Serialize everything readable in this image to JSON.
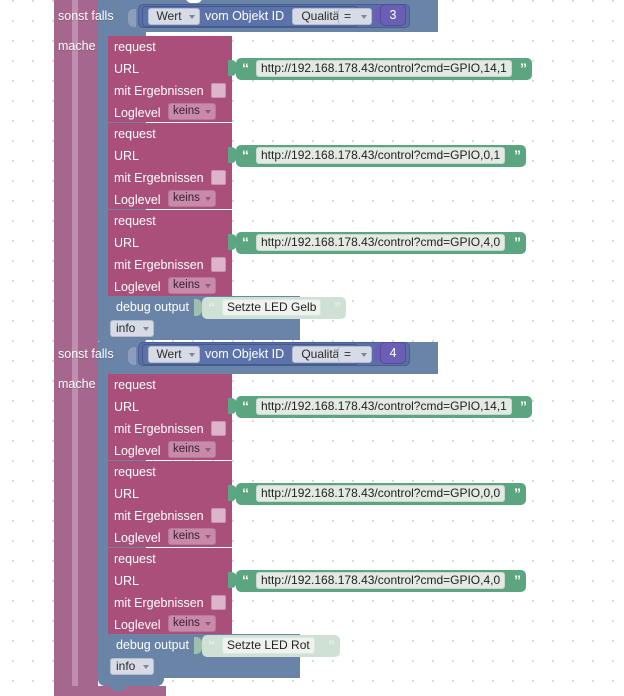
{
  "app": {
    "name": "blockly-workspace",
    "language": "de"
  },
  "colors": {
    "control_pink": "#a5678e",
    "control_pink_light": "#b27ba0",
    "logic_blue": "#6a84a8",
    "compare_blue": "#5a6fa8",
    "request_magenta": "#aa4f79",
    "text_green": "#5ba681",
    "text_green_faded": "#cfe0d5",
    "number_purple": "#6b5fb5",
    "grid_dot": "#d8d8d8",
    "canvas": "#ffffff"
  },
  "branches": [
    {
      "keyword": "sonst falls",
      "do_keyword": "mache",
      "condition": {
        "value_dropdown": "Wert",
        "connector_label": "vom Objekt ID",
        "object_id": "Qualität",
        "operator": "=",
        "number": "3"
      },
      "requests": [
        {
          "title": "request",
          "url_label": "URL",
          "url_value": "http://192.168.178.43/control?cmd=GPIO,14,1",
          "with_results_label": "mit Ergebnissen",
          "with_results_checked": false,
          "loglevel_label": "Loglevel",
          "loglevel_value": "keins"
        },
        {
          "title": "request",
          "url_label": "URL",
          "url_value": "http://192.168.178.43/control?cmd=GPIO,0,1",
          "with_results_label": "mit Ergebnissen",
          "with_results_checked": false,
          "loglevel_label": "Loglevel",
          "loglevel_value": "keins"
        },
        {
          "title": "request",
          "url_label": "URL",
          "url_value": "http://192.168.178.43/control?cmd=GPIO,4,0",
          "with_results_label": "mit Ergebnissen",
          "with_results_checked": false,
          "loglevel_label": "Loglevel",
          "loglevel_value": "keins"
        }
      ],
      "debug": {
        "label": "debug output",
        "message": "Setzte LED Gelb",
        "level": "info"
      }
    },
    {
      "keyword": "sonst falls",
      "do_keyword": "mache",
      "condition": {
        "value_dropdown": "Wert",
        "connector_label": "vom Objekt ID",
        "object_id": "Qualität",
        "operator": "=",
        "number": "4"
      },
      "requests": [
        {
          "title": "request",
          "url_label": "URL",
          "url_value": "http://192.168.178.43/control?cmd=GPIO,14,1",
          "with_results_label": "mit Ergebnissen",
          "with_results_checked": false,
          "loglevel_label": "Loglevel",
          "loglevel_value": "keins"
        },
        {
          "title": "request",
          "url_label": "URL",
          "url_value": "http://192.168.178.43/control?cmd=GPIO,0,0",
          "with_results_label": "mit Ergebnissen",
          "with_results_checked": false,
          "loglevel_label": "Loglevel",
          "loglevel_value": "keins"
        },
        {
          "title": "request",
          "url_label": "URL",
          "url_value": "http://192.168.178.43/control?cmd=GPIO,4,0",
          "with_results_label": "mit Ergebnissen",
          "with_results_checked": false,
          "loglevel_label": "Loglevel",
          "loglevel_value": "keins"
        }
      ],
      "debug": {
        "label": "debug output",
        "message": "Setzte LED Rot",
        "level": "info"
      }
    }
  ],
  "glyphs": {
    "quote_open": "“",
    "quote_close": "”"
  }
}
